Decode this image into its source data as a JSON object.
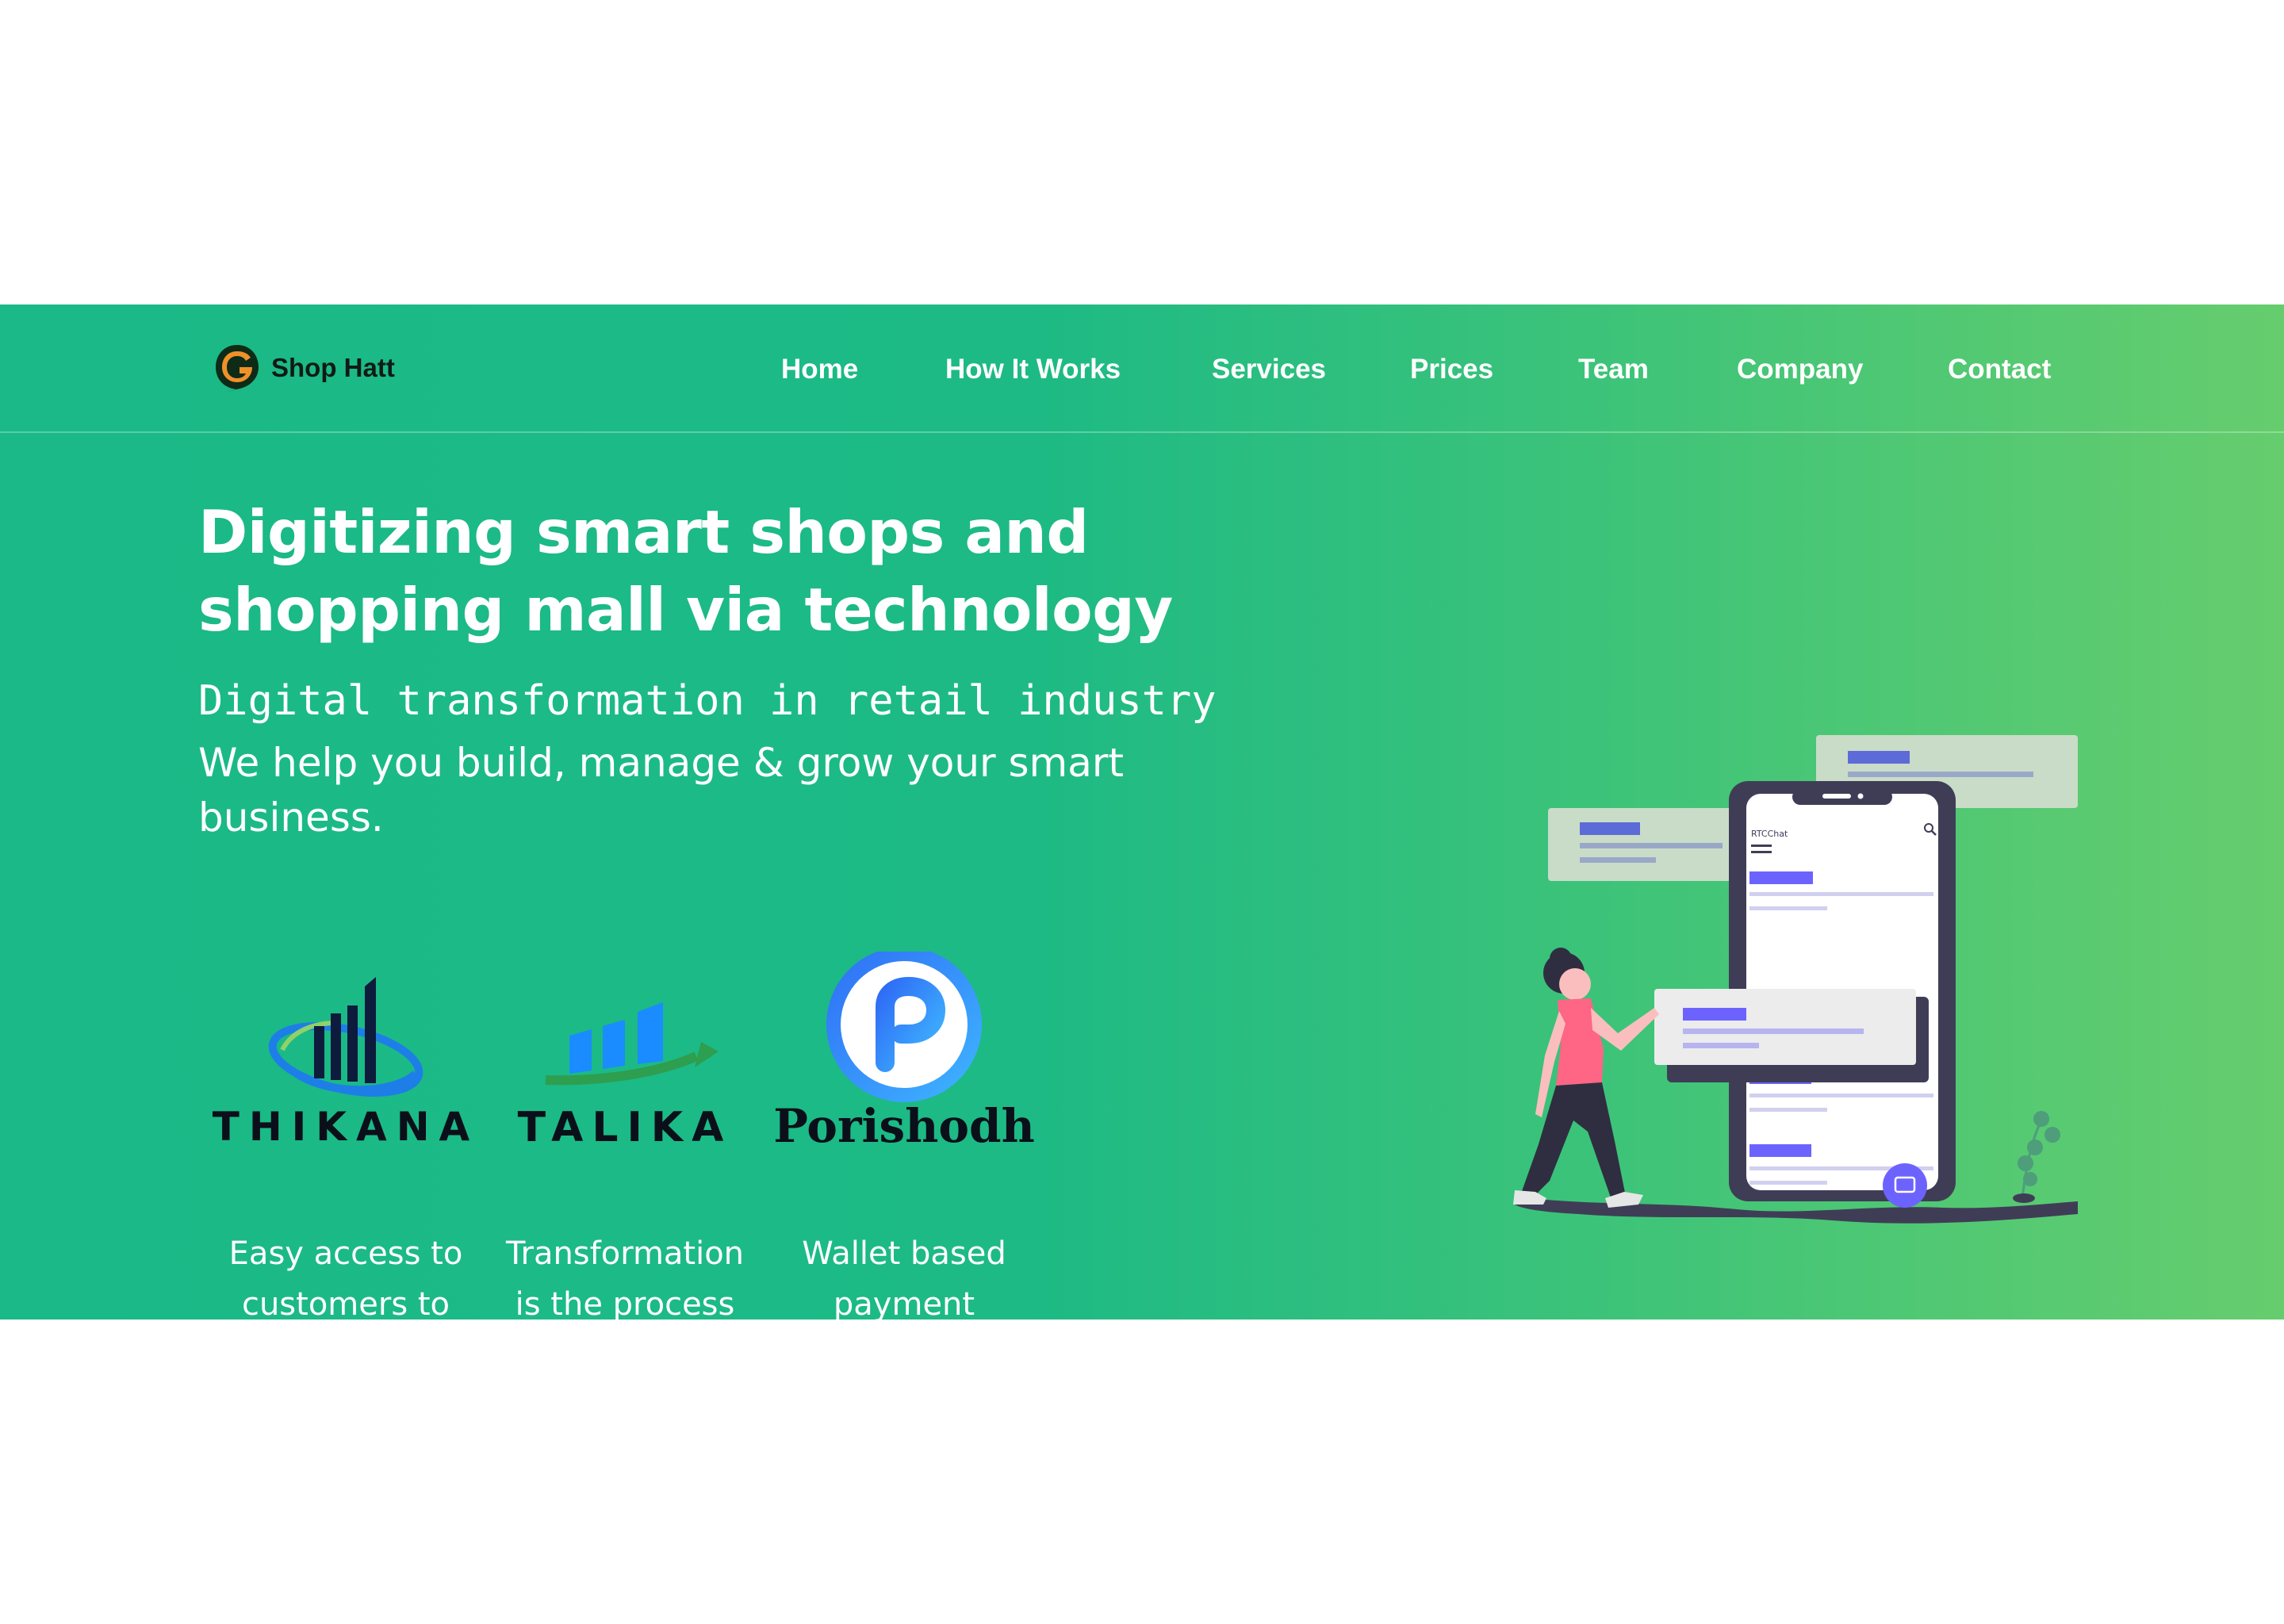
{
  "nav": {
    "brand": "Shop Hatt",
    "links": [
      "Home",
      "How It Works",
      "Services",
      "Prices",
      "Team",
      "Company",
      "Contact"
    ]
  },
  "hero": {
    "title_line1": "Digitizing smart shops and",
    "title_line2": "shopping mall via technology",
    "subtitle": "Digital transformation in retail industry",
    "description": "We help you build, manage & grow your smart business."
  },
  "products": [
    {
      "name": "THIKANA",
      "desc_line1": "Easy access to",
      "desc_line2": "customers to"
    },
    {
      "name": "TALIKA",
      "desc_line1": "Transformation",
      "desc_line2": "is the process"
    },
    {
      "name": "Porishodh",
      "desc_line1": "Wallet based",
      "desc_line2": "payment"
    }
  ],
  "illustration": {
    "app_label": "RTCChat"
  },
  "colors": {
    "gradient_start": "#1ab987",
    "gradient_end": "#66cd6e",
    "accent_purple": "#6c63ff",
    "dark_navy": "#0d1b3d",
    "chart_blue": "#1a8cff",
    "arrow_green": "#2e9e4f",
    "phone_dark": "#3f3d56",
    "shirt_pink": "#ff6584"
  }
}
